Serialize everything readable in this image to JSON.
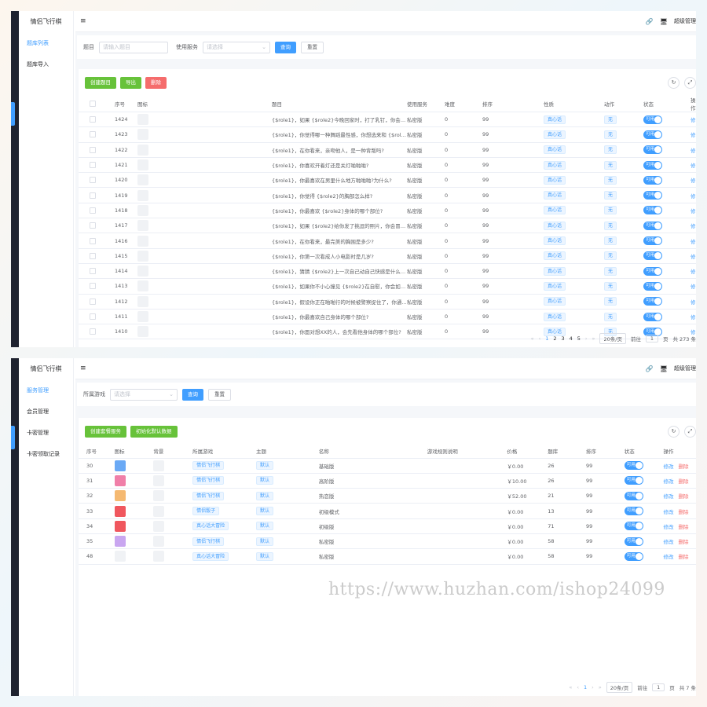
{
  "panel1": {
    "brand": "情侣飞行棋",
    "nav": [
      {
        "label": "题库列表",
        "active": true
      },
      {
        "label": "题库导入",
        "active": false
      }
    ],
    "user": "超级管理",
    "filter": {
      "q_label": "题目",
      "q_placeholder": "请输入题目",
      "svc_label": "使用服务",
      "svc_placeholder": "请选择",
      "search": "查询",
      "reset": "重置"
    },
    "actions": {
      "create": "创建题目",
      "export": "导出",
      "delete": "删除"
    },
    "headers": [
      "序号",
      "图标",
      "题目",
      "使用服务",
      "难度",
      "排序",
      "性质",
      "动作",
      "状态",
      "操作"
    ],
    "rows": [
      {
        "id": "1424",
        "q": "{$role1}，如果 {$role2}今晚回家时，打了乳钉，你会怎...",
        "svc": "私密版",
        "diff": "0",
        "sort": "99",
        "nature": "真心话",
        "action": "无"
      },
      {
        "id": "1423",
        "q": "{$role1}，你觉得哪一种舞蹈最性感，你想选来和 {$role2...",
        "svc": "私密版",
        "diff": "0",
        "sort": "99",
        "nature": "真心话",
        "action": "无"
      },
      {
        "id": "1422",
        "q": "{$role1}，在你看来，亲吻他人，是一种背叛吗?",
        "svc": "私密版",
        "diff": "0",
        "sort": "99",
        "nature": "真心话",
        "action": "无"
      },
      {
        "id": "1421",
        "q": "{$role1}，你喜欢开着灯还是关灯啪啪啪?",
        "svc": "私密版",
        "diff": "0",
        "sort": "99",
        "nature": "真心话",
        "action": "无"
      },
      {
        "id": "1420",
        "q": "{$role1}，你最喜欢在男里什么地方啪啪啪?为什么?",
        "svc": "私密版",
        "diff": "0",
        "sort": "99",
        "nature": "真心话",
        "action": "无"
      },
      {
        "id": "1419",
        "q": "{$role1}，你觉得 {$role2}的胸部怎么样?",
        "svc": "私密版",
        "diff": "0",
        "sort": "99",
        "nature": "真心话",
        "action": "无"
      },
      {
        "id": "1418",
        "q": "{$role1}，你最喜欢 {$role2}身体的哪个部位?",
        "svc": "私密版",
        "diff": "0",
        "sort": "99",
        "nature": "真心话",
        "action": "无"
      },
      {
        "id": "1417",
        "q": "{$role1}，如果 {$role2}给你发了挑逗的照片，你会冒着...",
        "svc": "私密版",
        "diff": "0",
        "sort": "99",
        "nature": "真心话",
        "action": "无"
      },
      {
        "id": "1416",
        "q": "{$role1}，在你看来，最完美的胸围是多少?",
        "svc": "私密版",
        "diff": "0",
        "sort": "99",
        "nature": "真心话",
        "action": "无"
      },
      {
        "id": "1415",
        "q": "{$role1}，你第一次看成人小电影时是几岁?",
        "svc": "私密版",
        "diff": "0",
        "sort": "99",
        "nature": "真心话",
        "action": "无"
      },
      {
        "id": "1414",
        "q": "{$role1}，猜猜 {$role2}上一次自己动自己快感是什么时...",
        "svc": "私密版",
        "diff": "0",
        "sort": "99",
        "nature": "真心话",
        "action": "无"
      },
      {
        "id": "1413",
        "q": "{$role1}，如果你不小心撞见 {$role2}在自慰，你会如何...",
        "svc": "私密版",
        "diff": "0",
        "sort": "99",
        "nature": "真心话",
        "action": "无"
      },
      {
        "id": "1412",
        "q": "{$role1}，假设你正在啪啪行的时候被警察捉住了，你通...",
        "svc": "私密版",
        "diff": "0",
        "sort": "99",
        "nature": "真心话",
        "action": "无"
      },
      {
        "id": "1411",
        "q": "{$role1}，你最喜欢自己身体的哪个部位?",
        "svc": "私密版",
        "diff": "0",
        "sort": "99",
        "nature": "真心话",
        "action": "无"
      },
      {
        "id": "1410",
        "q": "{$role1}，你面对想XX的人，会先看他身体的哪个部位?",
        "svc": "私密版",
        "diff": "0",
        "sort": "99",
        "nature": "真心话",
        "action": "无"
      }
    ],
    "switch_label": "可用",
    "edit": "修改",
    "del": "删除",
    "pager": {
      "pages": [
        "1",
        "2",
        "3",
        "4",
        "5"
      ],
      "size": "20条/页",
      "goto": "前往",
      "page_input": "1",
      "page_unit": "页",
      "total": "共 273 条"
    }
  },
  "panel2": {
    "brand": "情侣飞行棋",
    "nav": [
      {
        "label": "服务管理",
        "active": true
      },
      {
        "label": "会员管理",
        "active": false
      },
      {
        "label": "卡密管理",
        "active": false
      },
      {
        "label": "卡密领取记录",
        "active": false
      }
    ],
    "user": "超级管理",
    "filter": {
      "game_label": "所属游戏",
      "game_placeholder": "请选择",
      "search": "查询",
      "reset": "重置"
    },
    "actions": {
      "create": "创建套餐服务",
      "init": "初始化默认数据"
    },
    "headers": [
      "序号",
      "图标",
      "背景",
      "所属游戏",
      "主题",
      "名称",
      "游戏规则说明",
      "价格",
      "题库",
      "排序",
      "状态",
      "操作"
    ],
    "rows": [
      {
        "id": "30",
        "icon_color": "#6aa9f5",
        "game": "情侣飞行棋",
        "theme": "默认",
        "name": "基础版",
        "rules": "",
        "price": "￥0.00",
        "bank": "26",
        "sort": "99"
      },
      {
        "id": "31",
        "icon_color": "#f07fa8",
        "game": "情侣飞行棋",
        "theme": "默认",
        "name": "高阶版",
        "rules": "",
        "price": "￥10.00",
        "bank": "26",
        "sort": "99"
      },
      {
        "id": "32",
        "icon_color": "#f5b971",
        "game": "情侣飞行棋",
        "theme": "默认",
        "name": "热恋版",
        "rules": "",
        "price": "￥52.00",
        "bank": "21",
        "sort": "99"
      },
      {
        "id": "33",
        "icon_color": "#f0575e",
        "game": "情侣骰子",
        "theme": "默认",
        "name": "初级模式",
        "rules": "",
        "price": "￥0.00",
        "bank": "13",
        "sort": "99"
      },
      {
        "id": "34",
        "icon_color": "#f0575e",
        "game": "真心话大冒险",
        "theme": "默认",
        "name": "初级版",
        "rules": "",
        "price": "￥0.00",
        "bank": "71",
        "sort": "99"
      },
      {
        "id": "35",
        "icon_color": "#c9a6f0",
        "game": "情侣飞行棋",
        "theme": "默认",
        "name": "私密版",
        "rules": "",
        "price": "￥0.00",
        "bank": "58",
        "sort": "99"
      },
      {
        "id": "48",
        "icon_color": "",
        "game": "真心话大冒险",
        "theme": "默认",
        "name": "私密版",
        "rules": "",
        "price": "￥0.00",
        "bank": "58",
        "sort": "99"
      }
    ],
    "switch_label": "可用",
    "edit": "修改",
    "del": "删除",
    "pager": {
      "pages": [
        "1"
      ],
      "size": "20条/页",
      "goto": "前往",
      "page_input": "1",
      "page_unit": "页",
      "total": "共 7 条"
    }
  },
  "watermark": "https://www.huzhan.com/ishop24099"
}
